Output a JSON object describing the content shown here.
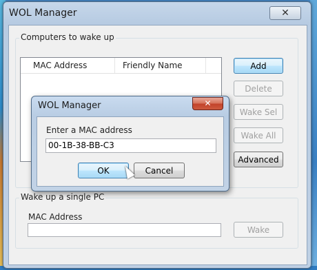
{
  "main_window": {
    "title": "WOL Manager",
    "close_glyph": "✕",
    "computers_group": {
      "label": "Computers to wake up",
      "columns": [
        "MAC Address",
        "Friendly Name"
      ],
      "rows": []
    },
    "buttons": {
      "add": "Add",
      "delete": "Delete",
      "wake_sel": "Wake Sel",
      "wake_all": "Wake All",
      "advanced": "Advanced"
    },
    "single_group": {
      "label": "Wake up a single PC",
      "mac_label": "MAC Address",
      "mac_value": "",
      "wake_button": "Wake"
    }
  },
  "dialog": {
    "title": "WOL Manager",
    "close_glyph": "✕",
    "prompt": "Enter a MAC address",
    "mac_value": "00-1B-38-BB-C3",
    "ok": "OK",
    "cancel": "Cancel"
  },
  "colors": {
    "title_bar": "#c6d7ea",
    "body": "#f0f0f0",
    "close_red": "#c2422a",
    "default_button": "#a7d9f5"
  }
}
